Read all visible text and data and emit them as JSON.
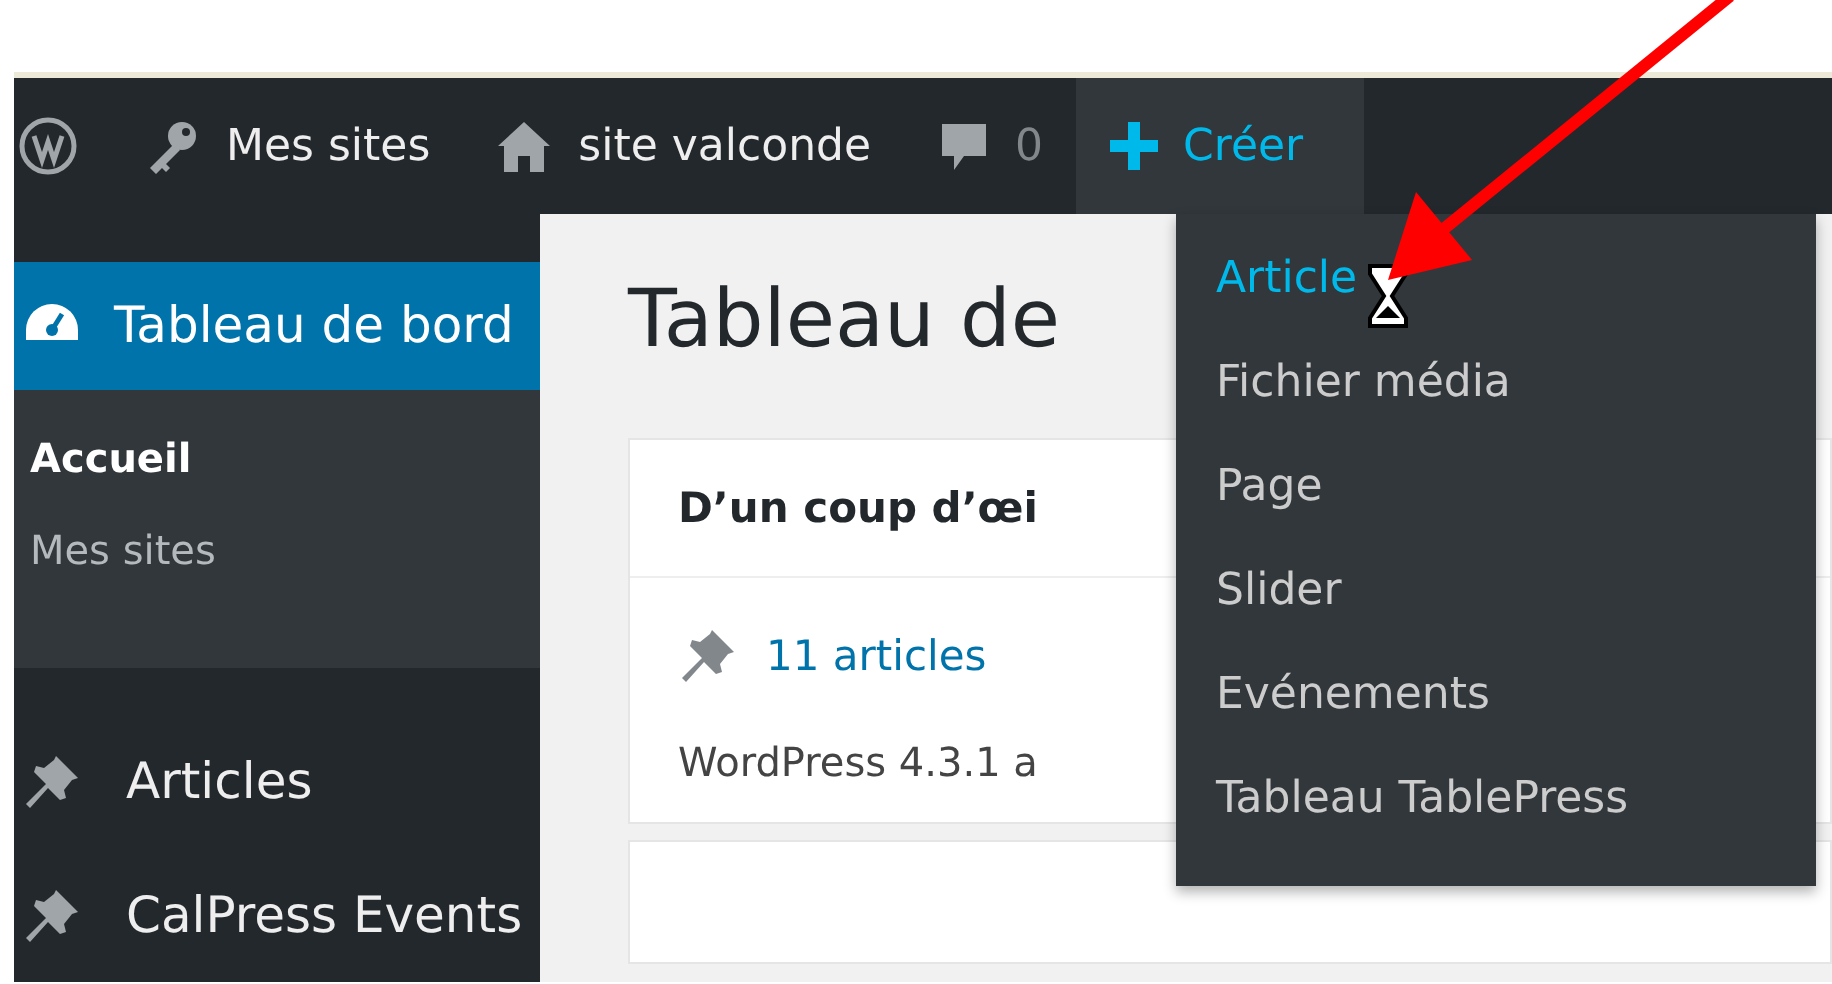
{
  "admin_bar": {
    "items": [
      {
        "kind": "logo"
      },
      {
        "kind": "key",
        "label": "Mes sites"
      },
      {
        "kind": "home",
        "label": "site valconde"
      },
      {
        "kind": "comments",
        "label": "0"
      },
      {
        "kind": "create",
        "label": "Créer",
        "selected": true
      }
    ]
  },
  "sidebar": {
    "current": {
      "label": "Tableau de bord",
      "selected": true
    },
    "submenu": [
      {
        "label": "Accueil",
        "selected": true
      },
      {
        "label": "Mes sites",
        "selected": false
      }
    ],
    "items": [
      {
        "label": "Articles"
      },
      {
        "label": "CalPress Events"
      }
    ]
  },
  "content": {
    "heading": "Tableau de",
    "card": {
      "title": "D’un coup d’œi",
      "stat": "11 articles",
      "text": "WordPress 4.3.1 a"
    }
  },
  "dropdown": {
    "items": [
      {
        "label": "Article",
        "selected": true
      },
      {
        "label": "Fichier média",
        "selected": false
      },
      {
        "label": "Page",
        "selected": false
      },
      {
        "label": "Slider",
        "selected": false
      },
      {
        "label": "Evénements",
        "selected": false
      },
      {
        "label": "Tableau TablePress",
        "selected": false
      }
    ]
  }
}
